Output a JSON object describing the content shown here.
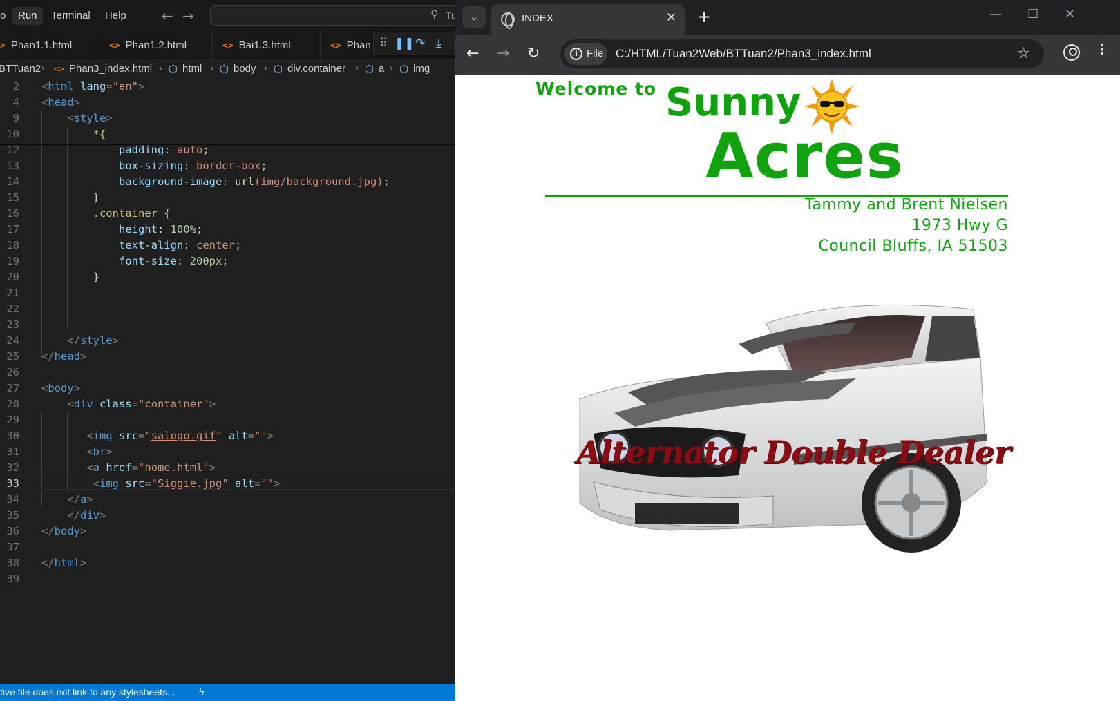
{
  "editor": {
    "menu": {
      "partial_left": "o",
      "run": "Run",
      "terminal": "Terminal",
      "help": "Help"
    },
    "search_partial": "Tu",
    "tabs": [
      {
        "label": "Phan1.1.html"
      },
      {
        "label": "Phan1.2.html"
      },
      {
        "label": "Bai1.3.html"
      },
      {
        "label": "Phan"
      }
    ],
    "breadcrumb": {
      "folder": "BTTuan2",
      "file": "Phan3_index.html",
      "items": [
        "html",
        "body",
        "div.container",
        "a",
        "img"
      ]
    },
    "lines": [
      {
        "n": "2"
      },
      {
        "n": "4"
      },
      {
        "n": "9"
      },
      {
        "n": "10"
      },
      {
        "n": "12"
      },
      {
        "n": "13"
      },
      {
        "n": "14"
      },
      {
        "n": "15"
      },
      {
        "n": "16"
      },
      {
        "n": "17"
      },
      {
        "n": "18"
      },
      {
        "n": "19"
      },
      {
        "n": "20"
      },
      {
        "n": "21"
      },
      {
        "n": "22"
      },
      {
        "n": "23"
      },
      {
        "n": "24"
      },
      {
        "n": "25"
      },
      {
        "n": "26"
      },
      {
        "n": "27"
      },
      {
        "n": "28"
      },
      {
        "n": "29"
      },
      {
        "n": "30"
      },
      {
        "n": "31"
      },
      {
        "n": "32"
      },
      {
        "n": "33"
      },
      {
        "n": "34"
      },
      {
        "n": "35"
      },
      {
        "n": "36"
      },
      {
        "n": "37"
      },
      {
        "n": "38"
      },
      {
        "n": "39"
      }
    ],
    "code": {
      "html_tag": "html",
      "lang_attr": "lang",
      "lang_val": "\"en\"",
      "head": "head",
      "style": "style",
      "star": "*{",
      "padding": "padding",
      "padding_val": "auto",
      "box_sizing": "box-sizing",
      "box_sizing_val": "border-box",
      "bg_image": "background-image",
      "url_fn": "url",
      "url_arg": "(img/background.jpg)",
      "close_brace": "}",
      "container_sel": ".container",
      "open_brace": "{",
      "height": "height",
      "height_val": "100%",
      "text_align": "text-align",
      "text_align_val": "center",
      "font_size": "font-size",
      "font_size_val": "200px",
      "style_close": "style",
      "head_close": "head",
      "body": "body",
      "div": "div",
      "class_attr": "class",
      "class_val": "\"container\"",
      "img": "img",
      "src_attr": "src",
      "src1": "salogo.gif",
      "alt_attr": "alt",
      "alt_val": "\"\"",
      "br": "br",
      "a": "a",
      "href_attr": "href",
      "href_val": "home.html",
      "src2": "Siggie.jpg",
      "a_close": "a",
      "div_close": "div",
      "body_close": "body",
      "html_close": "html"
    },
    "status_message": "tive file does not link to any stylesheets..."
  },
  "browser": {
    "tab_title": "INDEX",
    "file_label": "File",
    "url": "C:/HTML/Tuan2Web/BTTuan2/Phan3_index.html",
    "page": {
      "welcome": "Welcome to",
      "sunny": "Sunny",
      "acres": "Acres",
      "owners": "Tammy and Brent Nielsen",
      "street": "1973 Hwy G",
      "city": "Council Bluffs, IA  51503",
      "car_caption": "Alternator Double Dealer"
    }
  },
  "colors": {
    "brand_green": "#11a20f",
    "caption_red": "#8b0d14",
    "status_blue": "#0078d4"
  }
}
